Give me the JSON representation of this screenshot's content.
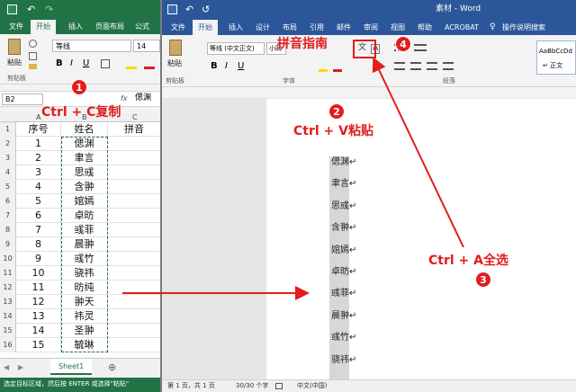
{
  "excel": {
    "title_bar": {
      "undo": "↶",
      "redo": "↷"
    },
    "tabs": [
      "文件",
      "开始",
      "插入",
      "页面布局",
      "公式"
    ],
    "active_tab": "开始",
    "ribbon": {
      "font_name": "等线",
      "font_size": "14",
      "paste_label": "粘贴",
      "clipboard_label": "剪贴板",
      "bold": "B",
      "italic": "I",
      "underline": "U"
    },
    "name_box": "B2",
    "formula_fx": "fx",
    "formula_value": "偲渊",
    "columns": [
      "A",
      "B",
      "C"
    ],
    "headers": [
      "序号",
      "姓名",
      "拼音"
    ],
    "rows": [
      {
        "n": "2",
        "idx": "1",
        "name": "偲渊"
      },
      {
        "n": "3",
        "idx": "2",
        "name": "聿言"
      },
      {
        "n": "4",
        "idx": "3",
        "name": "思彧"
      },
      {
        "n": "5",
        "idx": "4",
        "name": "含翀"
      },
      {
        "n": "6",
        "idx": "5",
        "name": "婠嫣"
      },
      {
        "n": "7",
        "idx": "6",
        "name": "卓昉"
      },
      {
        "n": "8",
        "idx": "7",
        "name": "彧菲"
      },
      {
        "n": "9",
        "idx": "8",
        "name": "晨翀"
      },
      {
        "n": "10",
        "idx": "9",
        "name": "彧竹"
      },
      {
        "n": "11",
        "idx": "10",
        "name": "骁祎"
      },
      {
        "n": "12",
        "idx": "11",
        "name": "昉纯"
      },
      {
        "n": "13",
        "idx": "12",
        "name": "翀天"
      },
      {
        "n": "14",
        "idx": "13",
        "name": "祎灵"
      },
      {
        "n": "15",
        "idx": "14",
        "name": "圣翀"
      },
      {
        "n": "16",
        "idx": "15",
        "name": "毓琳"
      }
    ],
    "row1_num": "1",
    "sheet_tab": "Sheet1",
    "add_sheet": "⊕",
    "status_text": "选定目标区域，然后按 ENTER 或选择\"粘贴\""
  },
  "word": {
    "title": "素材 - Word",
    "tabs": [
      "文件",
      "开始",
      "插入",
      "设计",
      "布局",
      "引用",
      "邮件",
      "审阅",
      "视图",
      "帮助",
      "ACROBAT",
      "操作说明搜索"
    ],
    "active_tab": "开始",
    "ribbon": {
      "paste_label": "粘贴",
      "clipboard_label": "剪贴板",
      "font_name": "等线 (中文正文)",
      "font_size": "小四",
      "font_group_label": "字体",
      "paragraph_label": "段落",
      "style_preview": "AaBbCcDd",
      "style_name": "↵ 正文",
      "pinyin_icon": "文",
      "border_char": "A"
    },
    "document_lines": [
      "偲渊↵",
      "聿言↵",
      "思彧↵",
      "含翀↵",
      "婠嫣↵",
      "卓昉↵",
      "彧菲↵",
      "晨翀↵",
      "彧竹↵",
      "骁祎↵"
    ],
    "status": {
      "page": "第 1 页，共 1 页",
      "words": "30/30 个字",
      "lang": "中文(中国)"
    }
  },
  "annotations": {
    "step1": "1",
    "step1_text": "Ctrl + C复制",
    "step2": "2",
    "step2_text": "Ctrl + V粘贴",
    "step3": "3",
    "step3_text": "Ctrl + A全选",
    "step4": "4",
    "step4_text": "拼音指南"
  },
  "colors": {
    "excel_green": "#217346",
    "word_blue": "#2b579a",
    "annotation_red": "#e11d1d"
  }
}
